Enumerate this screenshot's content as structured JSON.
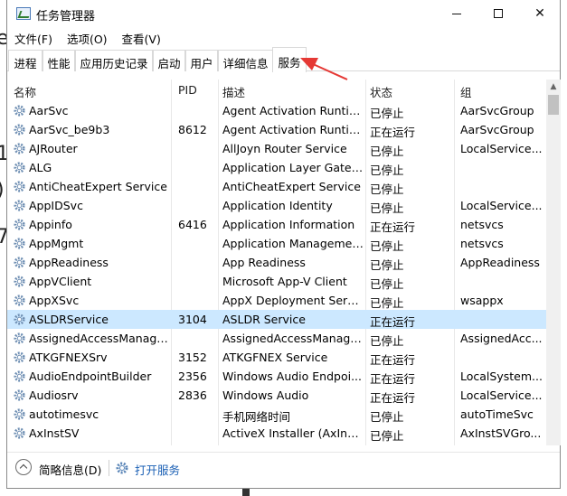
{
  "window": {
    "title": "任务管理器"
  },
  "menu": [
    "文件(F)",
    "选项(O)",
    "查看(V)"
  ],
  "tabs": [
    "进程",
    "性能",
    "应用历史记录",
    "启动",
    "用户",
    "详细信息",
    "服务"
  ],
  "active_tab": "服务",
  "columns": {
    "name": "名称",
    "pid": "PID",
    "desc": "描述",
    "status": "状态",
    "group": "组"
  },
  "rows": [
    {
      "name": "AarSvc",
      "pid": "",
      "desc": "Agent Activation Runtime",
      "status": "已停止",
      "group": "AarSvcGroup"
    },
    {
      "name": "AarSvc_be9b3",
      "pid": "8612",
      "desc": "Agent Activation Runtim...",
      "status": "正在运行",
      "group": "AarSvcGroup"
    },
    {
      "name": "AJRouter",
      "pid": "",
      "desc": "AllJoyn Router Service",
      "status": "已停止",
      "group": "LocalService..."
    },
    {
      "name": "ALG",
      "pid": "",
      "desc": "Application Layer Gatew...",
      "status": "已停止",
      "group": ""
    },
    {
      "name": "AntiCheatExpert Service",
      "pid": "",
      "desc": "AntiCheatExpert Service",
      "status": "已停止",
      "group": ""
    },
    {
      "name": "AppIDSvc",
      "pid": "",
      "desc": "Application Identity",
      "status": "已停止",
      "group": "LocalService..."
    },
    {
      "name": "Appinfo",
      "pid": "6416",
      "desc": "Application Information",
      "status": "正在运行",
      "group": "netsvcs"
    },
    {
      "name": "AppMgmt",
      "pid": "",
      "desc": "Application Management",
      "status": "已停止",
      "group": "netsvcs"
    },
    {
      "name": "AppReadiness",
      "pid": "",
      "desc": "App Readiness",
      "status": "已停止",
      "group": "AppReadiness"
    },
    {
      "name": "AppVClient",
      "pid": "",
      "desc": "Microsoft App-V Client",
      "status": "已停止",
      "group": ""
    },
    {
      "name": "AppXSvc",
      "pid": "",
      "desc": "AppX Deployment Servi...",
      "status": "已停止",
      "group": "wsappx"
    },
    {
      "name": "ASLDRService",
      "pid": "3104",
      "desc": "ASLDR Service",
      "status": "正在运行",
      "group": ""
    },
    {
      "name": "AssignedAccessManager...",
      "pid": "",
      "desc": "AssignedAccessManage...",
      "status": "已停止",
      "group": "AssignedAcc..."
    },
    {
      "name": "ATKGFNEXSrv",
      "pid": "3152",
      "desc": "ATKGFNEX Service",
      "status": "正在运行",
      "group": ""
    },
    {
      "name": "AudioEndpointBuilder",
      "pid": "2356",
      "desc": "Windows Audio Endpoi...",
      "status": "正在运行",
      "group": "LocalSystem..."
    },
    {
      "name": "Audiosrv",
      "pid": "2836",
      "desc": "Windows Audio",
      "status": "正在运行",
      "group": "LocalService..."
    },
    {
      "name": "autotimesvc",
      "pid": "",
      "desc": "手机网络时间",
      "status": "已停止",
      "group": "autoTimeSvc"
    },
    {
      "name": "AxInstSV",
      "pid": "",
      "desc": "ActiveX Installer (AxInst...",
      "status": "已停止",
      "group": "AxInstSVGro..."
    }
  ],
  "selected_row": "ASLDRService",
  "footer": {
    "less_details": "简略信息(D)",
    "open_services": "打开服务"
  },
  "colors": {
    "selection": "#cce8ff",
    "link": "#1a5fb4",
    "annotation_arrow": "#e53935"
  }
}
